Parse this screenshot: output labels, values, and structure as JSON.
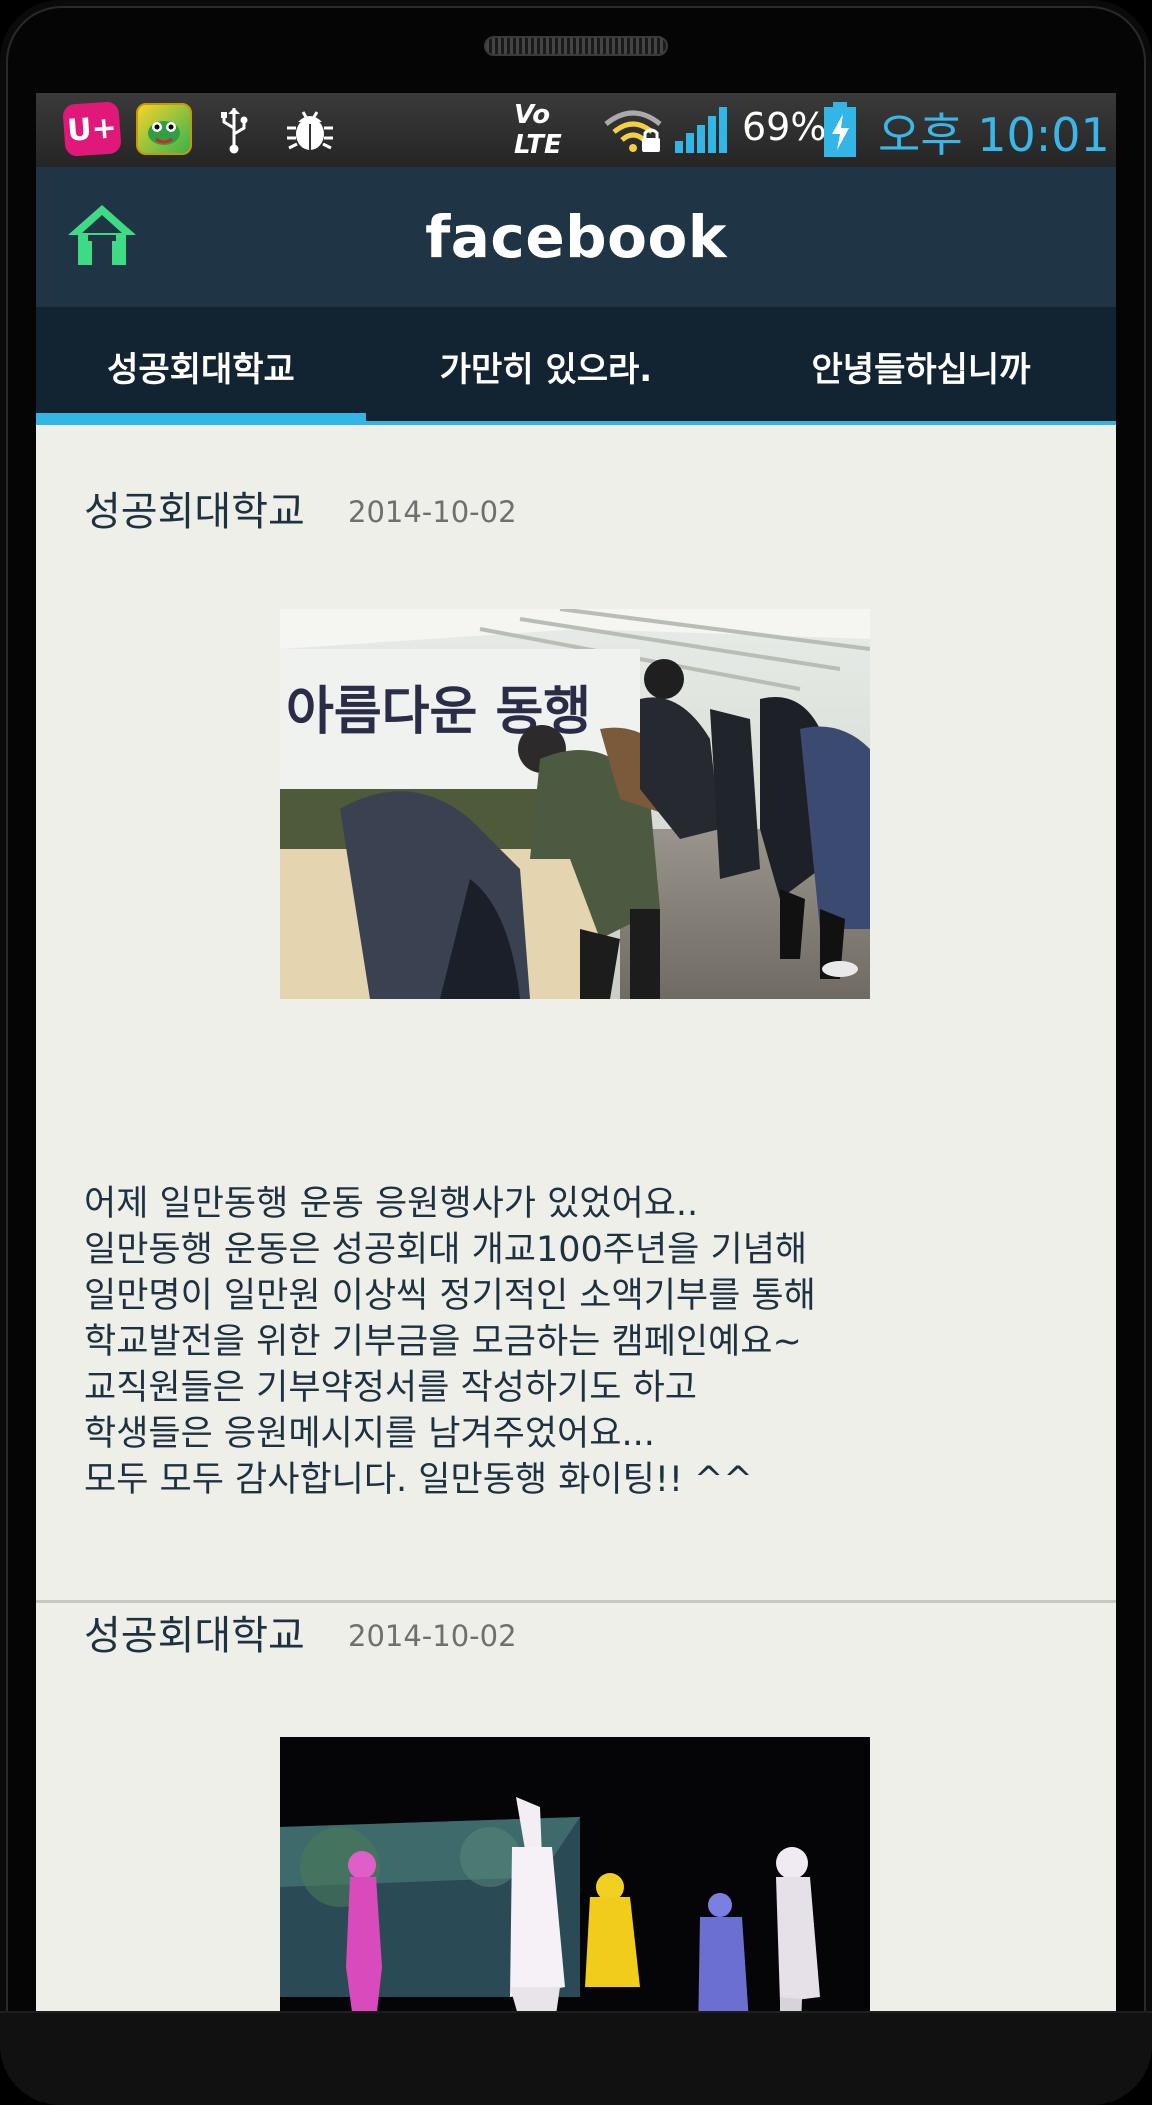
{
  "status_bar": {
    "carrier_badge": "U+",
    "network_label": "Vo LTE",
    "battery_percent": "69%",
    "time": "오후 10:01"
  },
  "action_bar": {
    "title": "facebook",
    "icon": "home-icon",
    "accent": "#3ddc84"
  },
  "tabs": [
    {
      "label": "성공회대학교",
      "selected": true
    },
    {
      "label": "가만히 있으라.",
      "selected": false
    },
    {
      "label": "안녕들하십니까",
      "selected": false
    }
  ],
  "colors": {
    "action_bar_bg": "#1f3444",
    "tab_bar_bg": "#122432",
    "tab_indicator": "#33b5e5",
    "feed_bg": "#efefea",
    "time_color": "#3ab6e8"
  },
  "posts": [
    {
      "author": "성공회대학교",
      "date": "2014-10-02",
      "banner_text": "아름다운 동행",
      "text": "어제 일만동행 운동 응원행사가 있었어요..\n일만동행 운동은 성공회대 개교100주년을 기념해\n일만명이 일만원 이상씩 정기적인 소액기부를 통해\n학교발전을 위한 기부금을 모금하는 캠페인예요~\n교직원들은 기부약정서를 작성하기도 하고\n학생들은 응원메시지를 남겨주었어요...\n모두 모두 감사합니다. 일만동행 화이팅!! ^^"
    },
    {
      "author": "성공회대학교",
      "date": "2014-10-02",
      "text": ""
    }
  ]
}
